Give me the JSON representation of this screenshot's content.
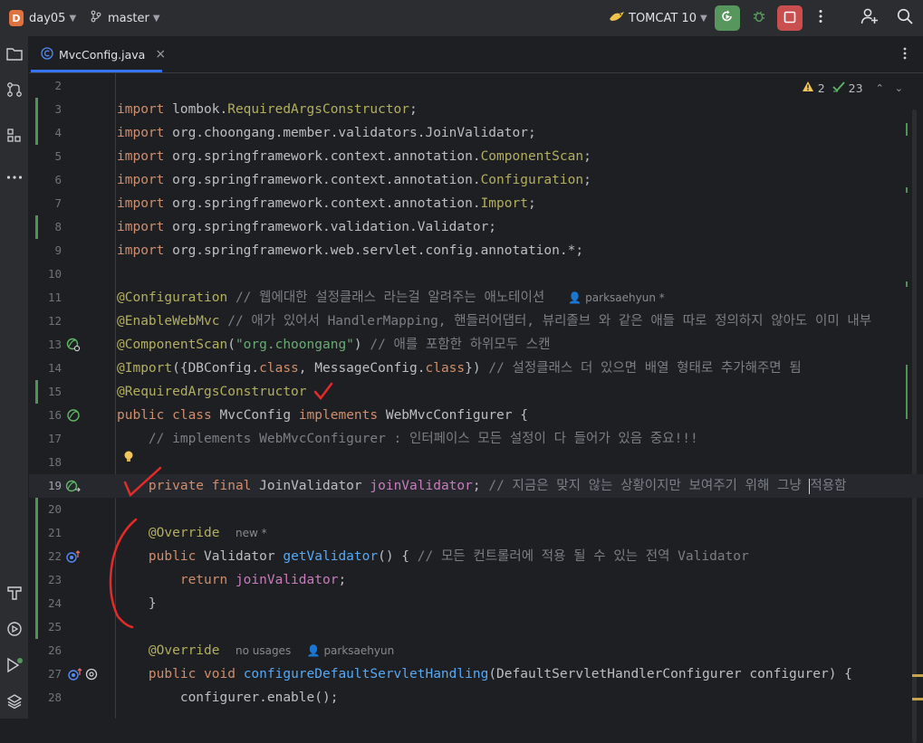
{
  "titlebar": {
    "project_initial": "D",
    "project_name": "day05",
    "branch": "master",
    "run_config": "TOMCAT 10",
    "icons": [
      "branch-icon",
      "tomcat-icon",
      "rerun-icon",
      "debug-icon",
      "stop-icon",
      "more-icon",
      "add-user-icon",
      "search-icon"
    ],
    "colors": {
      "rerun": "#57965c",
      "stop": "#c94f4f",
      "badge": "#e0723e"
    }
  },
  "sidebar": {
    "icons": [
      "folder-icon",
      "commit-icon",
      "structure-icon",
      "more-tools-icon",
      "build-icon",
      "services-icon",
      "problems-icon",
      "layers-icon"
    ]
  },
  "tab": {
    "filename": "MvcConfig.java",
    "close": "×"
  },
  "inspections": {
    "warnings": "2",
    "ok": "23"
  },
  "editor": {
    "lines": [
      {
        "n": "2",
        "code": ""
      },
      {
        "n": "3",
        "code": "import lombok.RequiredArgsConstructor;"
      },
      {
        "n": "4",
        "code": "import org.choongang.member.validators.JoinValidator;"
      },
      {
        "n": "5",
        "code": "import org.springframework.context.annotation.ComponentScan;"
      },
      {
        "n": "6",
        "code": "import org.springframework.context.annotation.Configuration;"
      },
      {
        "n": "7",
        "code": "import org.springframework.context.annotation.Import;"
      },
      {
        "n": "8",
        "code": "import org.springframework.validation.Validator;"
      },
      {
        "n": "9",
        "code": "import org.springframework.web.servlet.config.annotation.*;"
      },
      {
        "n": "10",
        "code": ""
      },
      {
        "n": "11",
        "code": "@Configuration // 웹에대한 설정클래스 라는걸 알려주는 애노테이션"
      },
      {
        "n": "12",
        "code": "@EnableWebMvc // 애가 있어서 HandlerMapping, 핸들러어댑터, 뷰리졸브 와 같은 애들 따로 정의하지 않아도 이미 내부"
      },
      {
        "n": "13",
        "code": "@ComponentScan(\"org.choongang\") // 애를 포함한 하위모두 스캔"
      },
      {
        "n": "14",
        "code": "@Import({DBConfig.class, MessageConfig.class}) // 설정클래스 더 있으면 배열 형태로 추가해주면 됨"
      },
      {
        "n": "15",
        "code": "@RequiredArgsConstructor"
      },
      {
        "n": "16",
        "code": "public class MvcConfig implements WebMvcConfigurer {"
      },
      {
        "n": "17",
        "code": "    // implements WebMvcConfigurer : 인터페이스 모든 설정이 다 들어가 있음 중요!!!"
      },
      {
        "n": "18",
        "code": ""
      },
      {
        "n": "19",
        "code": "    private final JoinValidator joinValidator; // 지금은 맞지 않는 상황이지만 보여주기 위해 그냥 적용함"
      },
      {
        "n": "20",
        "code": ""
      },
      {
        "n": "21",
        "code": "    @Override"
      },
      {
        "n": "22",
        "code": "    public Validator getValidator() { // 모든 컨트롤러에 적용 될 수 있는 전역 Validator"
      },
      {
        "n": "23",
        "code": "        return joinValidator;"
      },
      {
        "n": "24",
        "code": "    }"
      },
      {
        "n": "25",
        "code": ""
      },
      {
        "n": "26",
        "code": "    @Override"
      },
      {
        "n": "27",
        "code": "    public void configureDefaultServletHandling(DefaultServletHandlerConfigurer configurer) {"
      },
      {
        "n": "28",
        "code": "        configurer.enable();"
      }
    ],
    "hints": {
      "l11": "parksaehyun *",
      "l21": "new *",
      "l26_usages": "no usages",
      "l26_author": "parksaehyun"
    },
    "tokens": {
      "import": "import ",
      "lombok_pkg": "lombok.",
      "lombok_cls": "RequiredArgsConstructor",
      "semi": ";",
      "l4": "org.choongang.member.validators.JoinValidator;",
      "ctx_pkg": "org.springframework.context.annotation.",
      "l5_cls": "ComponentScan",
      "l6_cls": "Configuration",
      "l7_cls": "Import",
      "l8": "org.springframework.validation.Validator;",
      "l9": "org.springframework.web.servlet.config.annotation.*;",
      "a_configuration": "@Configuration",
      "c11": " // 웹에대한 설정클래스 라는걸 알려주는 애노테이션",
      "a_enable": "@EnableWebMvc",
      "c12": " // 애가 있어서 HandlerMapping, 핸들러어댑터, 뷰리졸브 와 같은 애들 따로 정의하지 않아도 이미 내부",
      "a_scan": "@ComponentScan",
      "p_open": "(",
      "str13": "\"org.choongang\"",
      "p_close": ")",
      "c13": " // 애를 포함한 하위모두 스캔",
      "a_import": "@Import",
      "l14_a": "({DBConfig.",
      "kw_class": "class",
      "l14_b": ", MessageConfig.",
      "l14_c": "})",
      "c14": " // 설정클래스 더 있으면 배열 형태로 추가해주면 됨",
      "a_rac": "@RequiredArgsConstructor",
      "kw_public": "public ",
      "kw_class_sp": "class ",
      "l16_name": "MvcConfig ",
      "kw_implements": "implements ",
      "l16_rest": "WebMvcConfigurer {",
      "c17": "    // implements WebMvcConfigurer : 인터페이스 모든 설정이 다 들어가 있음 중요!!!",
      "indent4": "    ",
      "indent8": "        ",
      "kw_private": "private ",
      "kw_final": "final ",
      "l19_type": "JoinValidator ",
      "f_joinValidator": "joinValidator",
      "c19a": " // 지금은 맞지 않는 상황이지만 보여주기 위해 그냥 ",
      "c19b": "적용함",
      "a_override": "@Override",
      "l22_type": "Validator ",
      "fn_getValidator": "getValidator",
      "l22_rest": "() { ",
      "c22": "// 모든 컨트롤러에 적용 될 수 있는 전역 Validator",
      "kw_return": "return ",
      "brace_close": "}",
      "kw_void": "void ",
      "fn_configure": "configureDefaultServletHandling",
      "l27_rest": "(DefaultServletHandlerConfigurer configurer) {",
      "l28": "configurer.enable();"
    }
  }
}
